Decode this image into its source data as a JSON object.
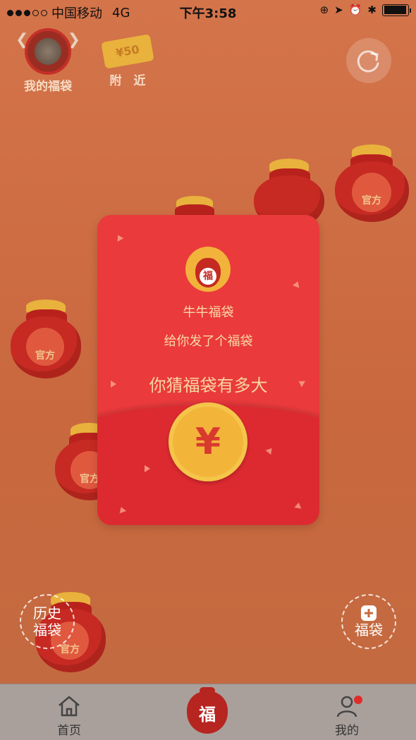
{
  "status_bar": {
    "carrier": "中国移动",
    "network": "4G",
    "time": "下午3:58",
    "signal_bars": 3,
    "battery_level": 0.95
  },
  "top": {
    "my_bag_label": "我的福袋",
    "nearby_label": "附　近",
    "ticket_text": "¥50"
  },
  "background_bags": {
    "badge_text": "官方"
  },
  "modal": {
    "sender_name": "牛牛福袋",
    "message": "给你发了个福袋",
    "prompt": "你猜福袋有多大",
    "coin_symbol": "¥",
    "avatar_badge": "福"
  },
  "side_buttons": {
    "history_line1": "历史",
    "history_line2": "福袋",
    "add_line": "福袋"
  },
  "tabbar": {
    "home": "首页",
    "center": "福",
    "mine": "我的"
  },
  "colors": {
    "modal_red": "#ea3a3c",
    "coin_gold": "#f2b53a",
    "background": "#c86a3c"
  }
}
